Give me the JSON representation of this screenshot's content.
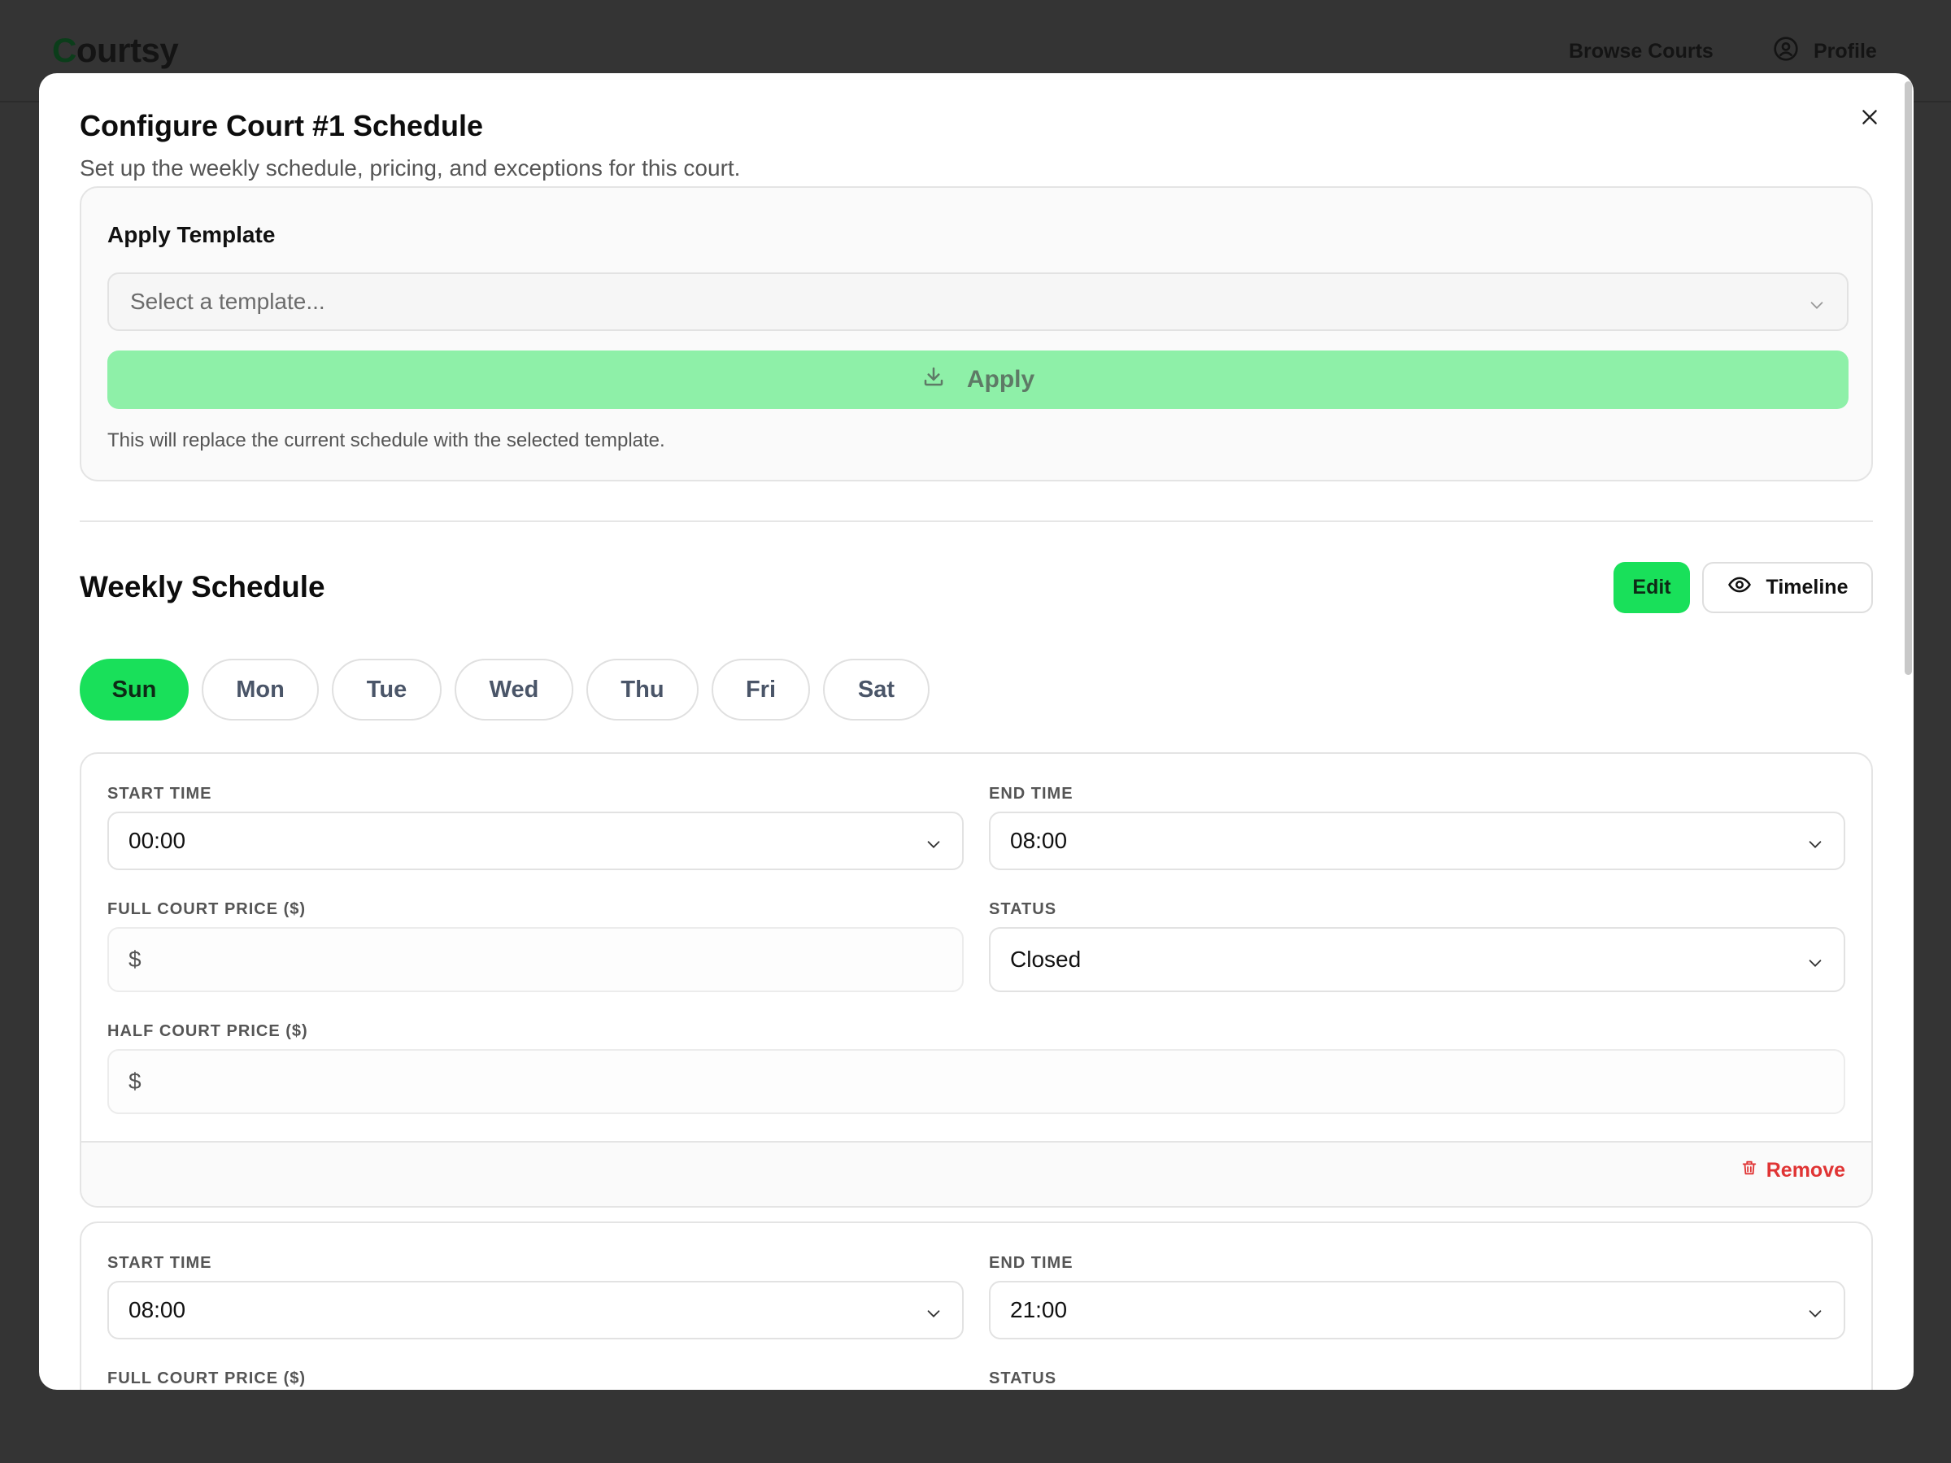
{
  "app": {
    "logo_first": "C",
    "logo_rest": "ourtsy",
    "nav_browse": "Browse Courts",
    "nav_profile": "Profile"
  },
  "modal": {
    "title": "Configure Court #1 Schedule",
    "subtitle": "Set up the weekly schedule, pricing, and exceptions for this court."
  },
  "template": {
    "label": "Apply Template",
    "placeholder": "Select a template...",
    "apply_label": "Apply",
    "note": "This will replace the current schedule with the selected template."
  },
  "weekly": {
    "title": "Weekly Schedule",
    "edit_label": "Edit",
    "timeline_label": "Timeline",
    "days": [
      "Sun",
      "Mon",
      "Tue",
      "Wed",
      "Thu",
      "Fri",
      "Sat"
    ],
    "active_day": "Sun"
  },
  "labels": {
    "start_time": "START TIME",
    "end_time": "END TIME",
    "full_price": "FULL COURT PRICE ($)",
    "status": "STATUS",
    "half_price": "HALF COURT PRICE ($)",
    "currency": "$",
    "remove": "Remove"
  },
  "slots": [
    {
      "start": "00:00",
      "end": "08:00",
      "status": "Closed"
    },
    {
      "start": "08:00",
      "end": "21:00"
    }
  ],
  "colors": {
    "accent": "#19e05a",
    "apply_disabled": "#8ef0a8",
    "danger": "#e03434",
    "overlay": "#343434"
  }
}
